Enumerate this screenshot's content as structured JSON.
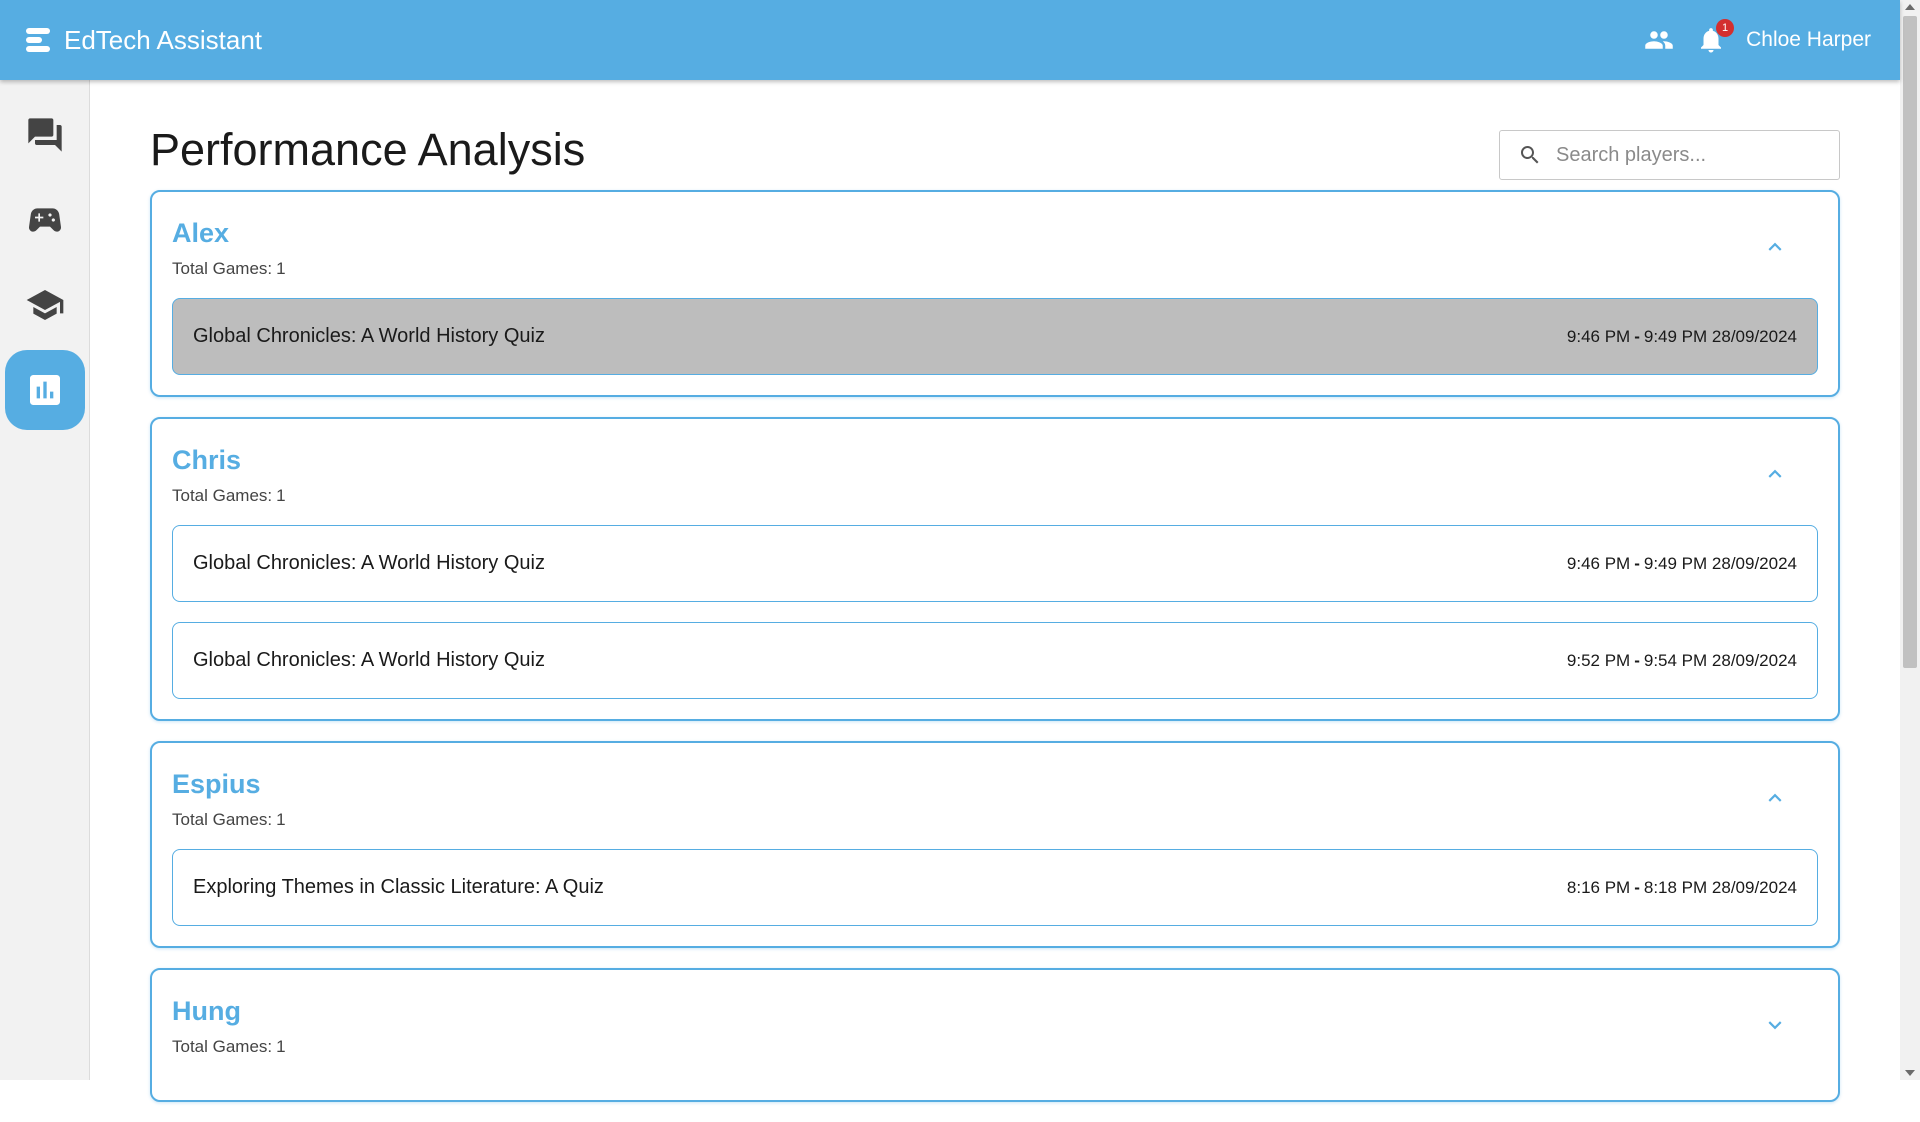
{
  "header": {
    "app_title": "EdTech Assistant",
    "user_name": "Chloe Harper",
    "notification_count": "1",
    "bg_color": "#56ade2"
  },
  "sidebar": {
    "items": [
      {
        "name": "chat",
        "icon": "forum-icon",
        "active": false
      },
      {
        "name": "games",
        "icon": "gamepad-icon",
        "active": false
      },
      {
        "name": "courses",
        "icon": "school-icon",
        "active": false
      },
      {
        "name": "analytics",
        "icon": "bar-chart-icon",
        "active": true
      }
    ]
  },
  "main": {
    "page_title": "Performance Analysis",
    "search_placeholder": "Search players...",
    "total_games_label": "Total Games:",
    "players": [
      {
        "name": "Alex",
        "total_games": "1",
        "expanded": true,
        "games": [
          {
            "title": "Global Chronicles: A World History Quiz",
            "start": "9:46 PM",
            "end": "9:49 PM 28/09/2024",
            "selected": true
          }
        ]
      },
      {
        "name": "Chris",
        "total_games": "1",
        "expanded": true,
        "games": [
          {
            "title": "Global Chronicles: A World History Quiz",
            "start": "9:46 PM",
            "end": "9:49 PM 28/09/2024",
            "selected": false
          },
          {
            "title": "Global Chronicles: A World History Quiz",
            "start": "9:52 PM",
            "end": "9:54 PM 28/09/2024",
            "selected": false
          }
        ]
      },
      {
        "name": "Espius",
        "total_games": "1",
        "expanded": true,
        "games": [
          {
            "title": "Exploring Themes in Classic Literature: A Quiz",
            "start": "8:16 PM",
            "end": "8:18 PM 28/09/2024",
            "selected": false
          }
        ]
      },
      {
        "name": "Hung",
        "total_games": "1",
        "expanded": false,
        "games": []
      }
    ]
  },
  "time_separator": "-"
}
